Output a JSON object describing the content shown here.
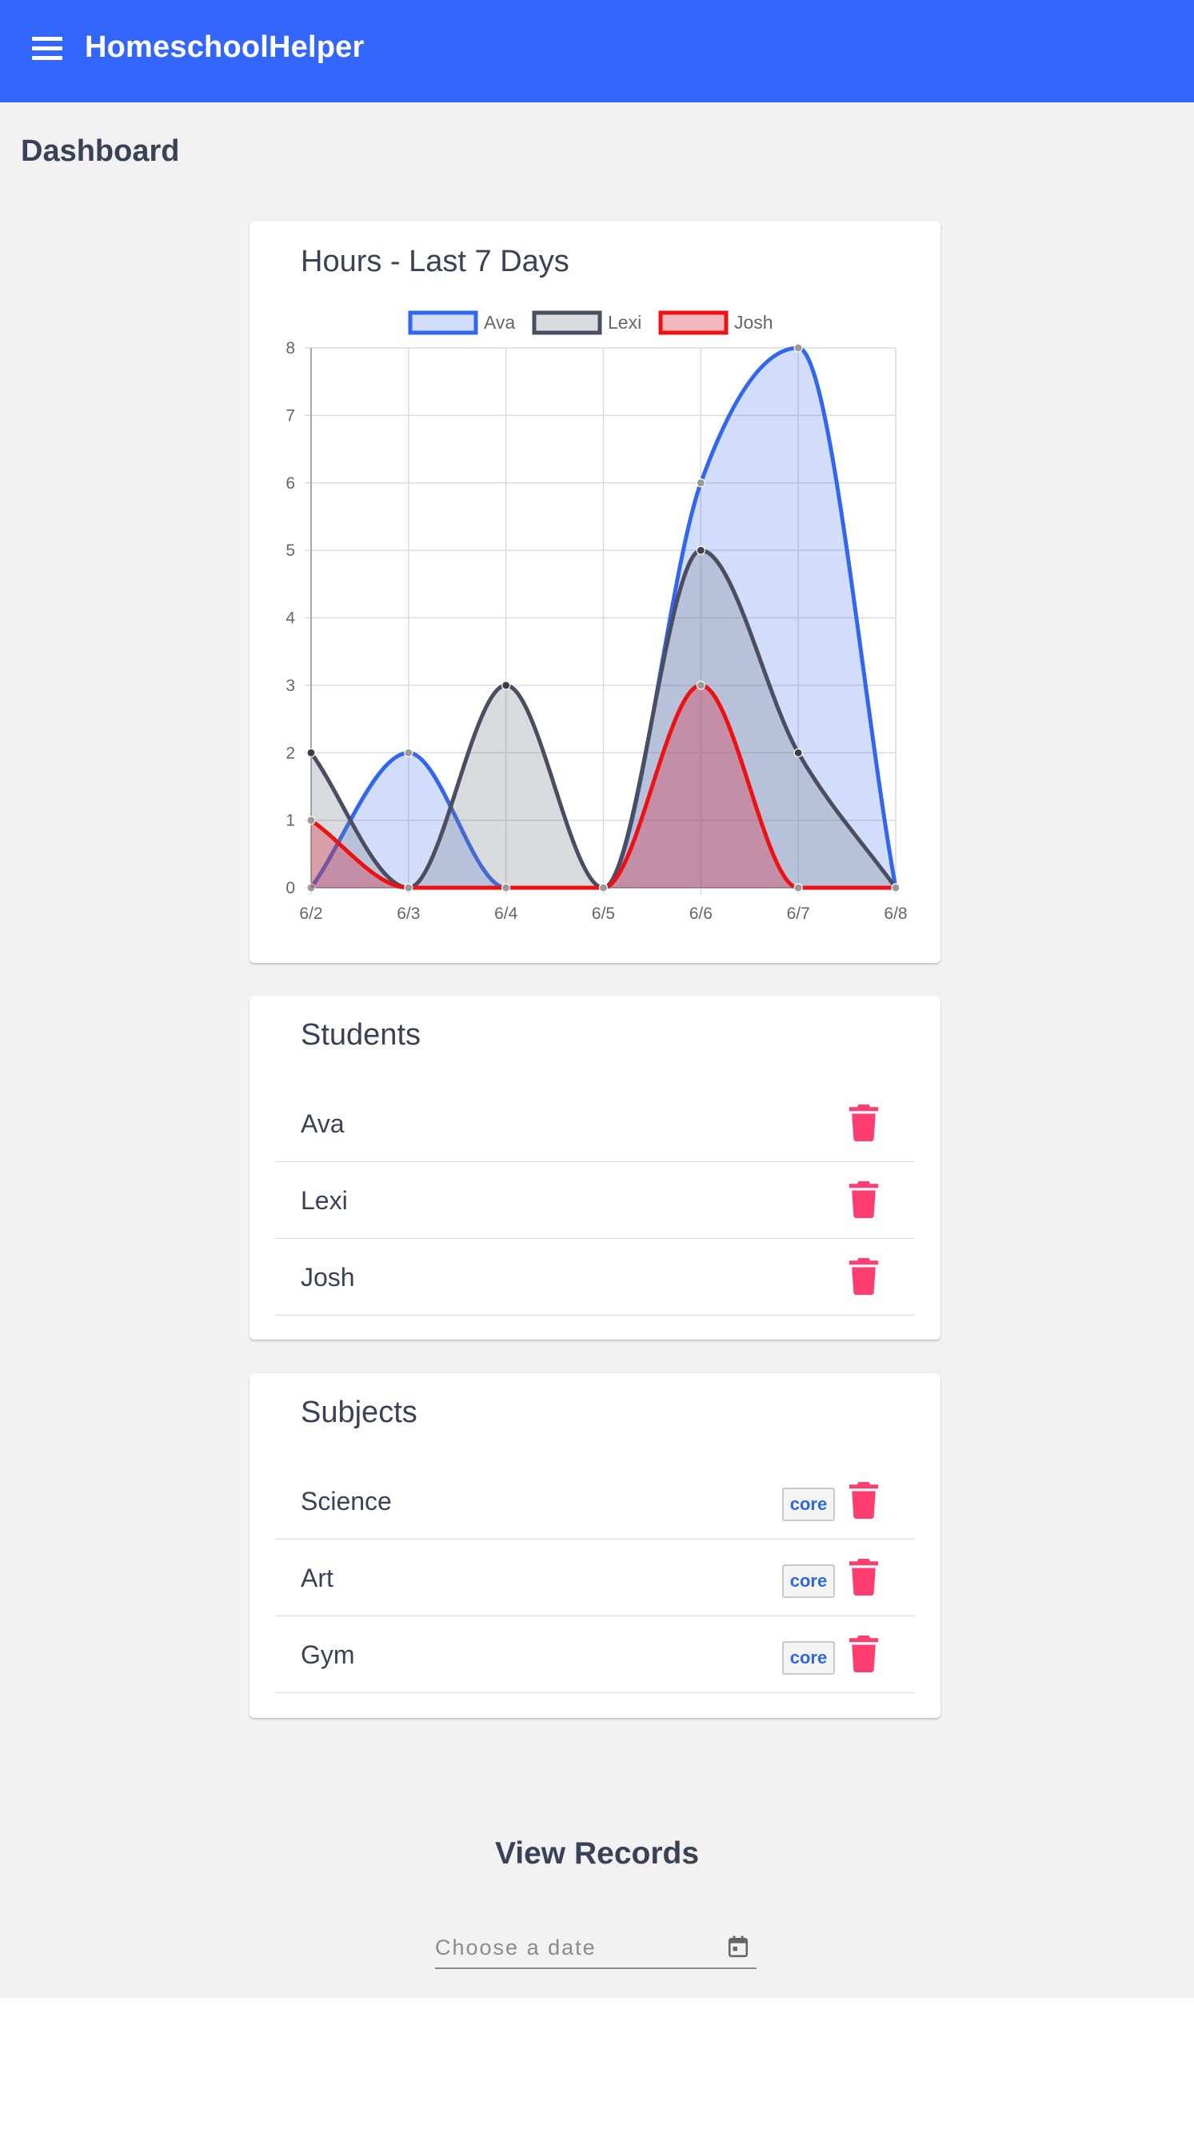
{
  "header": {
    "title": "HomeschoolHelper",
    "menu_icon": "hamburger-menu-icon"
  },
  "page": {
    "title": "Dashboard"
  },
  "chart_card": {
    "title": "Hours - Last 7 Days"
  },
  "chart_data": {
    "type": "area",
    "title": "Hours - Last 7 Days",
    "categories": [
      "6/2",
      "6/3",
      "6/4",
      "6/5",
      "6/6",
      "6/7",
      "6/8"
    ],
    "ylim": [
      0,
      8
    ],
    "yticks": [
      0,
      1,
      2,
      3,
      4,
      5,
      6,
      7,
      8
    ],
    "legend_position": "top-center",
    "grid": true,
    "series": [
      {
        "name": "Ava",
        "values": [
          0,
          2,
          0,
          0,
          6,
          8,
          0
        ],
        "stroke": "#3366ee",
        "fill": "rgba(51,102,238,0.22)",
        "point": "#9a9a9a"
      },
      {
        "name": "Lexi",
        "values": [
          2,
          0,
          3,
          0,
          5,
          2,
          0
        ],
        "stroke": "#4a4e60",
        "fill": "rgba(120,122,132,0.28)",
        "point": "#3a3d4a"
      },
      {
        "name": "Josh",
        "values": [
          1,
          0,
          0,
          0,
          3,
          0,
          0
        ],
        "stroke": "#ee1111",
        "fill": "rgba(220,40,60,0.33)",
        "point": "#999999"
      }
    ]
  },
  "students": {
    "title": "Students",
    "items": [
      {
        "name": "Ava"
      },
      {
        "name": "Lexi"
      },
      {
        "name": "Josh"
      }
    ]
  },
  "subjects": {
    "title": "Subjects",
    "items": [
      {
        "name": "Science",
        "badge": "core"
      },
      {
        "name": "Art",
        "badge": "core"
      },
      {
        "name": "Gym",
        "badge": "core"
      }
    ]
  },
  "records": {
    "title": "View Records",
    "date_placeholder": "Choose a date",
    "calendar_icon": "calendar-icon"
  },
  "colors": {
    "primary": "#3366ff",
    "delete": "#ff3d6e",
    "badge_text": "#3366dd",
    "background": "#f2f2f2"
  }
}
